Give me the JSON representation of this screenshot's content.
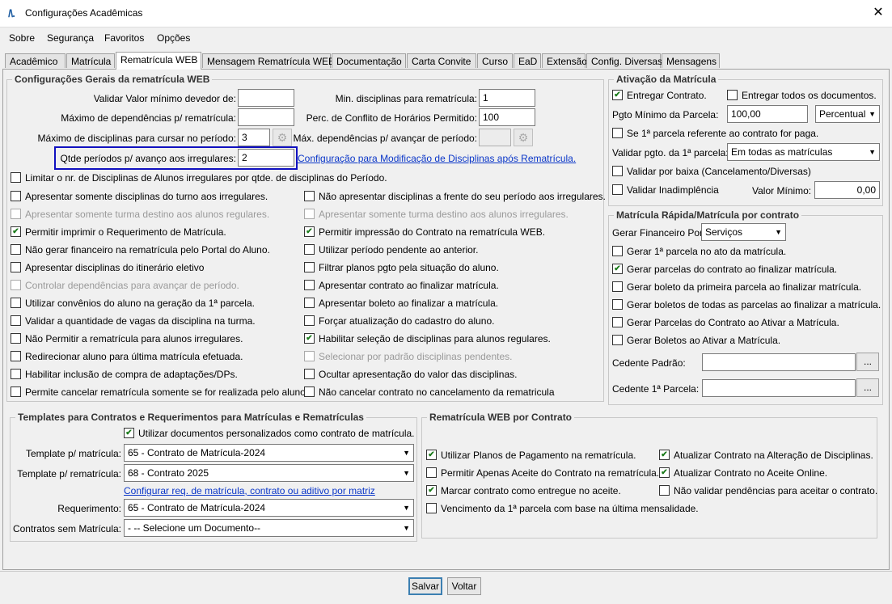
{
  "window": {
    "title": "Configurações Acadêmicas",
    "logo": "/\\."
  },
  "menu": [
    "Sobre",
    "Segurança",
    "Favoritos",
    "Opções"
  ],
  "tabs": [
    "Acadêmico",
    "Matrícula",
    "Rematrícula WEB",
    "Mensagem Rematrícula WEB",
    "Documentação",
    "Carta Convite",
    "Curso",
    "EaD",
    "Extensão",
    "Config. Diversas",
    "Mensagens"
  ],
  "geral": {
    "title": "Configurações Gerais da rematrícula WEB",
    "valor_minimo_label": "Validar Valor mínimo devedor de:",
    "valor_minimo_value": "",
    "max_dependencias_label": "Máximo de dependências p/ rematrícula:",
    "max_dependencias_value": "",
    "max_disciplinas_label": "Máximo de disciplinas para cursar no período:",
    "max_disciplinas_value": "3",
    "qtde_periodos_label": "Qtde períodos p/ avanço aos irregulares:",
    "qtde_periodos_value": "2",
    "min_disciplinas_label": "Min. disciplinas para rematrícula:",
    "min_disciplinas_value": "1",
    "perc_conflito_label": "Perc. de Conflito de Horários Permitido:",
    "perc_conflito_value": "100",
    "max_dep_avancar_label": "Máx. dependências p/ avançar de período:",
    "max_dep_avancar_value": "",
    "config_link": "Configuração para Modificação de Disciplinas após Rematrícula.",
    "limitar": "Limitar o nr. de Disciplinas de Alunos irregulares por qtde. de disciplinas do Período.",
    "left_checks": [
      {
        "label": "Apresentar somente disciplinas do turno aos irregulares.",
        "checked": false,
        "disabled": false
      },
      {
        "label": "Apresentar somente turma destino aos alunos regulares.",
        "checked": false,
        "disabled": true
      },
      {
        "label": "Permitir imprimir o Requerimento de Matrícula.",
        "checked": true,
        "disabled": false
      },
      {
        "label": "Não gerar financeiro na rematrícula pelo Portal do Aluno.",
        "checked": false,
        "disabled": false
      },
      {
        "label": "Apresentar disciplinas do itinerário eletivo",
        "checked": false,
        "disabled": false
      },
      {
        "label": "Controlar dependências para avançar de período.",
        "checked": false,
        "disabled": true
      },
      {
        "label": "Utilizar convênios do aluno na geração da 1ª parcela.",
        "checked": false,
        "disabled": false
      },
      {
        "label": "Validar a quantidade de vagas da disciplina na turma.",
        "checked": false,
        "disabled": false
      },
      {
        "label": "Não Permitir a rematrícula para alunos irregulares.",
        "checked": false,
        "disabled": false
      },
      {
        "label": "Redirecionar aluno para última matrícula efetuada.",
        "checked": false,
        "disabled": false
      },
      {
        "label": "Habilitar inclusão de compra de adaptações/DPs.",
        "checked": false,
        "disabled": false
      },
      {
        "label": "Permite cancelar rematrícula somente se for realizada pelo aluno.",
        "checked": false,
        "disabled": false
      }
    ],
    "right_checks": [
      {
        "label": "Não apresentar disciplinas a frente do seu período aos irregulares.",
        "checked": false,
        "disabled": false
      },
      {
        "label": "Apresentar somente turma destino aos alunos irregulares.",
        "checked": false,
        "disabled": true
      },
      {
        "label": "Permitir impressão do Contrato na rematrícula WEB.",
        "checked": true,
        "disabled": false
      },
      {
        "label": "Utilizar período pendente ao anterior.",
        "checked": false,
        "disabled": false
      },
      {
        "label": "Filtrar planos pgto pela situação do aluno.",
        "checked": false,
        "disabled": false
      },
      {
        "label": "Apresentar contrato ao finalizar matrícula.",
        "checked": false,
        "disabled": false
      },
      {
        "label": "Apresentar boleto ao finalizar a matrícula.",
        "checked": false,
        "disabled": false
      },
      {
        "label": "Forçar atualização do cadastro do aluno.",
        "checked": false,
        "disabled": false
      },
      {
        "label": "Habilitar seleção de disciplinas para alunos regulares.",
        "checked": true,
        "disabled": false
      },
      {
        "label": "Selecionar por padrão disciplinas pendentes.",
        "checked": false,
        "disabled": true
      },
      {
        "label": "Ocultar apresentação do valor das disciplinas.",
        "checked": false,
        "disabled": false
      },
      {
        "label": "Não cancelar contrato no cancelamento da rematricula",
        "checked": false,
        "disabled": false
      }
    ]
  },
  "ativacao": {
    "title": "Ativação da Matrícula",
    "entregar_contrato": "Entregar Contrato.",
    "entregar_todos": "Entregar todos os documentos.",
    "pgto_minimo_label": "Pgto Mínimo da Parcela:",
    "pgto_minimo_value": "100,00",
    "pgto_tipo": "Percentual",
    "se_primeira": "Se 1ª parcela referente ao contrato for paga.",
    "validar_pgto_label": "Validar pgto. da 1ª parcela:",
    "validar_pgto_value": "Em todas as matrículas",
    "validar_baixa": "Validar por baixa (Cancelamento/Diversas)",
    "validar_inadimplencia": "Validar Inadimplência",
    "valor_minimo_label": "Valor Mínimo:",
    "valor_minimo_value": "0,00"
  },
  "rapida": {
    "title": "Matrícula Rápida/Matrícula por contrato",
    "gerar_fin_label": "Gerar Financeiro Por:",
    "gerar_fin_value": "Serviços",
    "checks": [
      {
        "label": "Gerar 1ª parcela no ato da matrícula.",
        "checked": false
      },
      {
        "label": "Gerar parcelas do contrato ao finalizar matrícula.",
        "checked": true
      },
      {
        "label": "Gerar boleto da primeira parcela ao finalizar matrícula.",
        "checked": false
      },
      {
        "label": "Gerar boletos de todas as parcelas ao finalizar a matrícula.",
        "checked": false
      },
      {
        "label": "Gerar Parcelas do Contrato ao Ativar a Matrícula.",
        "checked": false
      },
      {
        "label": "Gerar Boletos ao Ativar a Matrícula.",
        "checked": false
      }
    ],
    "cedente_label": "Cedente Padrão:",
    "cedente_value": "",
    "cedente1_label": "Cedente 1ª Parcela:",
    "cedente1_value": "",
    "dots": "..."
  },
  "templates": {
    "title": "Templates para Contratos e Requerimentos para Matrículas e Rematrículas",
    "utilizar_docs": "Utilizar documentos personalizados como contrato de matrícula.",
    "tpl_matricula_label": "Template p/ matrícula:",
    "tpl_matricula_value": "65 - Contrato de Matrícula-2024",
    "tpl_rematricula_label": "Template p/ rematrícula:",
    "tpl_rematricula_value": "68 - Contrato 2025",
    "config_link": "Configurar req. de matrícula, contrato ou aditivo por matriz",
    "requerimento_label": "Requerimento:",
    "requerimento_value": "65 - Contrato de Matrícula-2024",
    "sem_matricula_label": "Contratos sem Matrícula:",
    "sem_matricula_value": "- -- Selecione um Documento--"
  },
  "webcontrato": {
    "title": "Rematrícula WEB por Contrato",
    "left_checks": [
      {
        "label": "Utilizar Planos de Pagamento na rematrícula.",
        "checked": true
      },
      {
        "label": "Permitir Apenas Aceite do Contrato na rematrícula.",
        "checked": false
      },
      {
        "label": "Marcar contrato como entregue no aceite.",
        "checked": true
      },
      {
        "label": "Vencimento da 1ª parcela com base na última mensalidade.",
        "checked": false
      }
    ],
    "right_checks": [
      {
        "label": "Atualizar Contrato na Alteração de Disciplinas.",
        "checked": true
      },
      {
        "label": "Atualizar Contrato no Aceite Online.",
        "checked": true
      },
      {
        "label": "Não validar pendências para aceitar o contrato.",
        "checked": false
      }
    ]
  },
  "buttons": {
    "salvar": "Salvar",
    "voltar": "Voltar"
  },
  "check_mark": "✔"
}
